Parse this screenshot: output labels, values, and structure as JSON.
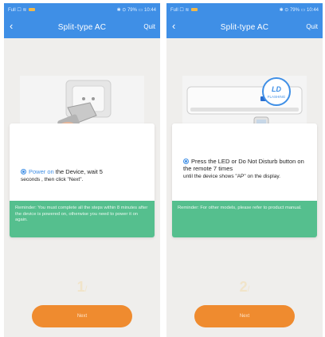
{
  "colors": {
    "primary": "#3f8fe6",
    "accent": "#ef8b2f",
    "reminder_bg": "#55bf8e",
    "page_bg": "#efeeec"
  },
  "icons": {
    "back": "chevron-left-icon",
    "step_marker": "radio-selected-icon"
  },
  "screens": [
    {
      "status_left": "Full ☐ ≋",
      "status_right": "✱ ⊙ 79% ▭ 10:44",
      "title": "Split-type AC",
      "quit": "Quit",
      "step_text_prefix": "Power on",
      "step_text_main": " the Device, wait 5",
      "step_text_sub": "seconds , then click \"Next\".",
      "reminder": "Reminder: You must complete all the steps within 8 minutes after the device is powered on, otherwise you need to power it on again.",
      "step_number": "1",
      "step_suffix": "/",
      "next_label": "Next"
    },
    {
      "status_left": "Full ☐ ≋",
      "status_right": "✱ ⊙ 79% ▭ 10:44",
      "title": "Split-type AC",
      "quit": "Quit",
      "step_text_main": "Press the LED or Do Not Disturb button on the remote 7 times",
      "step_text_sub": "until the device shows \"AP\" on the display.",
      "badge_top": "LD",
      "badge_bottom": "FLASHING",
      "reminder": "Reminder: For other models, please refer to product manual.",
      "step_number": "2",
      "step_suffix": "/",
      "next_label": "Next"
    }
  ]
}
